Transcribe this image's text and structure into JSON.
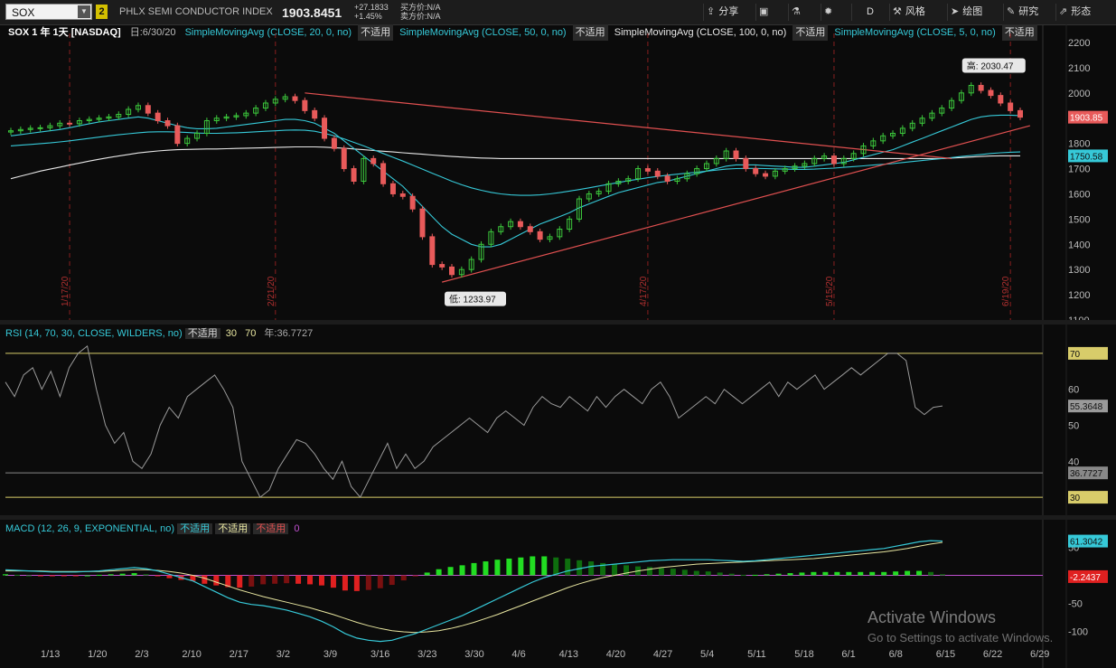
{
  "toolbar": {
    "symbol": "SOX",
    "link_number": "2",
    "index_name": "PHLX SEMI CONDUCTOR INDEX",
    "last_price": "1903.8451",
    "net_change": "+27.1833",
    "pct_change": "+1.45%",
    "bid": "买方价:N/A",
    "ask": "卖方价:N/A",
    "buttons": [
      "分享",
      "",
      "",
      "",
      "D",
      "风格",
      "绘图",
      "研究",
      "形态"
    ]
  },
  "legend": {
    "title": "SOX 1 年 1天 [NASDAQ]",
    "date": "日:6/30/20",
    "studies": [
      {
        "label": "SimpleMovingAvg (CLOSE, 20, 0, no)",
        "value": "不适用",
        "color": "#36c9d8"
      },
      {
        "label": "SimpleMovingAvg (CLOSE, 50, 0, no)",
        "value": "不适用",
        "color": "#36c9d8"
      },
      {
        "label": "SimpleMovingAvg (CLOSE, 100, 0, no)",
        "value": "不适用",
        "color": "#e8e8e8"
      },
      {
        "label": "SimpleMovingAvg (CLOSE, 5, 0, no)",
        "value": "不适用",
        "color": "#36c9d8"
      }
    ]
  },
  "rsi_legend": {
    "label": "RSI (14, 70, 30, CLOSE, WILDERS, no)",
    "value": "不适用",
    "ob": "30",
    "os": "70",
    "avg": "年:36.7727"
  },
  "macd_legend": {
    "label": "MACD (12, 26, 9, EXPONENTIAL, no)",
    "v1": "不适用",
    "v2": "不适用",
    "v3": "不适用",
    "v4": "0"
  },
  "watermark": {
    "line1": "Activate Windows",
    "line2": "Go to Settings to activate Windows."
  },
  "chart_data": [
    {
      "type": "candlestick",
      "ylim": [
        1100,
        2200
      ],
      "y_ticks": [
        1100,
        1200,
        1300,
        1400,
        1500,
        1600,
        1700,
        1800,
        1900,
        2000,
        2100,
        2200
      ],
      "x_labels": [
        "1/13",
        "1/20",
        "2/3",
        "2/10",
        "2/17",
        "3/2",
        "3/9",
        "3/16",
        "3/23",
        "3/30",
        "4/6",
        "4/13",
        "4/20",
        "4/27",
        "5/4",
        "5/11",
        "5/18",
        "6/1",
        "6/8",
        "6/15",
        "6/22",
        "6/29"
      ],
      "earnings_marks": [
        "1/17/20",
        "2/21/20",
        "4/17/20",
        "5/15/20",
        "6/19/20"
      ],
      "high_label": "高: 2030.47",
      "low_label": "低: 1233.97",
      "last_badge": "1903.85",
      "ma_badge": "1750.58",
      "closes": [
        1850,
        1855,
        1860,
        1862,
        1870,
        1880,
        1878,
        1890,
        1895,
        1900,
        1905,
        1915,
        1935,
        1950,
        1920,
        1890,
        1870,
        1800,
        1820,
        1840,
        1890,
        1900,
        1905,
        1910,
        1920,
        1940,
        1960,
        1975,
        1985,
        1970,
        1930,
        1900,
        1820,
        1780,
        1700,
        1650,
        1740,
        1720,
        1640,
        1600,
        1590,
        1540,
        1430,
        1320,
        1310,
        1280,
        1300,
        1340,
        1400,
        1450,
        1470,
        1490,
        1470,
        1450,
        1420,
        1430,
        1460,
        1500,
        1580,
        1600,
        1610,
        1640,
        1650,
        1660,
        1700,
        1690,
        1670,
        1650,
        1660,
        1680,
        1700,
        1720,
        1740,
        1770,
        1740,
        1700,
        1680,
        1670,
        1690,
        1700,
        1710,
        1720,
        1740,
        1750,
        1720,
        1740,
        1760,
        1790,
        1810,
        1830,
        1840,
        1860,
        1880,
        1900,
        1920,
        1940,
        1970,
        2000,
        2030,
        2010,
        1990,
        1960,
        1930,
        1903.85
      ],
      "ma20": [
        1830,
        1835,
        1840,
        1845,
        1850,
        1855,
        1862,
        1870,
        1878,
        1885,
        1890,
        1895,
        1900,
        1905,
        1900,
        1890,
        1880,
        1870,
        1862,
        1858,
        1858,
        1860,
        1865,
        1870,
        1875,
        1880,
        1885,
        1890,
        1895,
        1895,
        1890,
        1880,
        1860,
        1840,
        1810,
        1780,
        1750,
        1720,
        1690,
        1660,
        1630,
        1590,
        1550,
        1510,
        1470,
        1440,
        1420,
        1400,
        1390,
        1390,
        1400,
        1420,
        1440,
        1460,
        1480,
        1495,
        1510,
        1525,
        1545,
        1560,
        1575,
        1590,
        1605,
        1615,
        1625,
        1635,
        1645,
        1650,
        1660,
        1670,
        1680,
        1690,
        1700,
        1710,
        1715,
        1715,
        1715,
        1712,
        1710,
        1708,
        1705,
        1705,
        1710,
        1715,
        1720,
        1725,
        1735,
        1745,
        1755,
        1765,
        1775,
        1790,
        1805,
        1820,
        1835,
        1850,
        1865,
        1880,
        1895,
        1905,
        1910,
        1912,
        1912,
        1910
      ],
      "ma50": [
        1790,
        1793,
        1796,
        1799,
        1802,
        1806,
        1810,
        1815,
        1820,
        1825,
        1830,
        1834,
        1838,
        1842,
        1845,
        1846,
        1846,
        1845,
        1843,
        1841,
        1840,
        1840,
        1841,
        1842,
        1844,
        1846,
        1848,
        1850,
        1852,
        1853,
        1852,
        1848,
        1840,
        1830,
        1818,
        1804,
        1790,
        1775,
        1760,
        1745,
        1730,
        1714,
        1698,
        1682,
        1666,
        1650,
        1636,
        1624,
        1614,
        1606,
        1600,
        1596,
        1594,
        1594,
        1596,
        1600,
        1605,
        1611,
        1617,
        1624,
        1631,
        1638,
        1645,
        1652,
        1658,
        1664,
        1669,
        1674,
        1678,
        1682,
        1686,
        1690,
        1694,
        1698,
        1700,
        1701,
        1701,
        1700,
        1699,
        1698,
        1697,
        1697,
        1698,
        1700,
        1702,
        1705,
        1708,
        1711,
        1714,
        1717,
        1720,
        1724,
        1728,
        1732,
        1736,
        1740,
        1744,
        1748,
        1752,
        1756,
        1760,
        1763,
        1765,
        1766
      ],
      "ma100": [
        1660,
        1670,
        1680,
        1690,
        1698,
        1706,
        1714,
        1722,
        1730,
        1737,
        1744,
        1750,
        1756,
        1762,
        1766,
        1770,
        1773,
        1775,
        1776,
        1777,
        1778,
        1778,
        1779,
        1780,
        1781,
        1782,
        1783,
        1784,
        1785,
        1786,
        1786,
        1786,
        1785,
        1783,
        1781,
        1778,
        1775,
        1772,
        1769,
        1766,
        1763,
        1760,
        1757,
        1754,
        1751,
        1748,
        1746,
        1744,
        1742,
        1741,
        1740,
        1740,
        1740,
        1740,
        1740,
        1740,
        1740,
        1740,
        1740,
        1740,
        1740,
        1740,
        1740,
        1740,
        1740,
        1740,
        1740,
        1740,
        1740,
        1740,
        1740,
        1740,
        1740,
        1740,
        1740,
        1740,
        1740,
        1740,
        1740,
        1740,
        1740,
        1740,
        1740,
        1740,
        1740,
        1740,
        1740,
        1740,
        1740,
        1740,
        1740,
        1740,
        1740,
        1740,
        1740,
        1740,
        1742,
        1744,
        1746,
        1748,
        1750,
        1750.58,
        1750.58,
        1750.58
      ]
    },
    {
      "type": "line",
      "name": "RSI",
      "ylim": [
        25,
        75
      ],
      "y_ticks": [
        40,
        50,
        60
      ],
      "levels": [
        30,
        70
      ],
      "badges": [
        "70",
        "55.3648",
        "36.7727",
        "30"
      ],
      "values": [
        62,
        58,
        64,
        66,
        60,
        65,
        58,
        66,
        70,
        72,
        60,
        50,
        45,
        48,
        40,
        38,
        42,
        50,
        55,
        52,
        58,
        60,
        62,
        64,
        60,
        55,
        40,
        35,
        30,
        32,
        38,
        42,
        46,
        45,
        42,
        38,
        35,
        40,
        33,
        30,
        35,
        40,
        45,
        38,
        42,
        38,
        40,
        44,
        46,
        48,
        50,
        52,
        50,
        48,
        52,
        54,
        52,
        50,
        55,
        58,
        56,
        55,
        58,
        56,
        54,
        58,
        55,
        58,
        60,
        58,
        56,
        60,
        62,
        58,
        52,
        54,
        56,
        58,
        56,
        60,
        58,
        56,
        58,
        60,
        62,
        58,
        62,
        60,
        62,
        64,
        60,
        62,
        64,
        66,
        64,
        66,
        68,
        70,
        70,
        68,
        55,
        53,
        55,
        55.3648
      ]
    },
    {
      "type": "bar",
      "name": "MACD",
      "ylim": [
        -130,
        80
      ],
      "y_ticks": [
        -100,
        -50,
        0,
        50
      ],
      "badges": [
        "61.3042",
        "-2.2437"
      ],
      "macd": [
        10,
        9,
        8,
        7,
        6,
        6,
        6,
        7,
        8,
        10,
        12,
        14,
        12,
        8,
        2,
        -4,
        -10,
        -20,
        -30,
        -40,
        -48,
        -52,
        -54,
        -58,
        -62,
        -68,
        -74,
        -82,
        -92,
        -104,
        -112,
        -116,
        -118,
        -116,
        -110,
        -104,
        -96,
        -88,
        -80,
        -72,
        -62,
        -52,
        -42,
        -32,
        -22,
        -12,
        -4,
        2,
        8,
        12,
        16,
        18,
        20,
        22,
        24,
        26,
        27,
        28,
        28,
        28,
        28,
        27,
        26,
        25,
        26,
        28,
        30,
        32,
        34,
        36,
        38,
        40,
        42,
        44,
        46,
        48,
        52,
        56,
        60,
        62,
        61.3042
      ],
      "signal": [
        8,
        8,
        8,
        8,
        7,
        7,
        7,
        7,
        7,
        8,
        9,
        10,
        10,
        9,
        7,
        4,
        0,
        -5,
        -12,
        -19,
        -26,
        -32,
        -38,
        -43,
        -48,
        -53,
        -58,
        -64,
        -70,
        -77,
        -84,
        -90,
        -95,
        -99,
        -101,
        -102,
        -101,
        -99,
        -95,
        -90,
        -84,
        -77,
        -70,
        -62,
        -54,
        -46,
        -38,
        -30,
        -22,
        -15,
        -9,
        -4,
        0,
        4,
        8,
        11,
        14,
        16,
        18,
        20,
        21,
        22,
        23,
        24,
        25,
        26,
        27,
        28,
        29,
        30,
        32,
        34,
        36,
        38,
        40,
        42,
        45,
        48,
        52,
        56,
        59
      ],
      "histogram": [
        2,
        1,
        0,
        -1,
        -1,
        -1,
        -1,
        0,
        1,
        2,
        3,
        4,
        2,
        -1,
        -5,
        -8,
        -10,
        -15,
        -18,
        -21,
        -22,
        -20,
        -16,
        -15,
        -14,
        -15,
        -16,
        -18,
        -22,
        -27,
        -28,
        -26,
        -23,
        -17,
        -9,
        -2,
        5,
        11,
        15,
        18,
        22,
        25,
        28,
        30,
        32,
        34,
        34,
        32,
        30,
        27,
        25,
        22,
        20,
        18,
        16,
        15,
        13,
        12,
        10,
        8,
        7,
        5,
        3,
        1,
        1,
        2,
        3,
        4,
        5,
        6,
        6,
        6,
        6,
        6,
        6,
        6,
        7,
        8,
        8,
        6,
        2
      ]
    }
  ]
}
